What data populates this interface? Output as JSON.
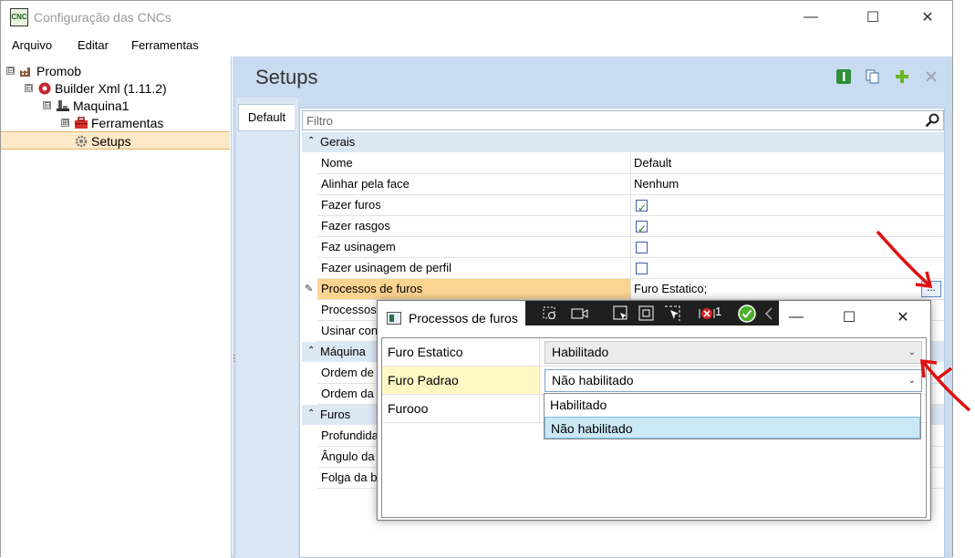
{
  "window": {
    "title": "Configuração das CNCs",
    "app_icon_text": "CNC",
    "controls": {
      "minimize": "—",
      "maximize": "☐",
      "close": "✕"
    }
  },
  "menu": [
    "Arquivo",
    "Editar",
    "Ferramentas"
  ],
  "tree": {
    "items": [
      {
        "label": "Promob",
        "expander": "⊟"
      },
      {
        "label": "Builder Xml (1.11.2)",
        "expander": "⊟"
      },
      {
        "label": "Maquina1",
        "expander": "⊟"
      },
      {
        "label": "Ferramentas",
        "expander": "⊞"
      },
      {
        "label": "Setups",
        "expander": ""
      }
    ]
  },
  "panel": {
    "title": "Setups",
    "tab": "Default",
    "filter_placeholder": "Filtro"
  },
  "grid": {
    "categories": [
      {
        "label": "Gerais"
      },
      {
        "label": "Máquina"
      },
      {
        "label": "Furos"
      }
    ],
    "gerais": [
      {
        "name": "Nome",
        "value": "Default"
      },
      {
        "name": "Alinhar pela face",
        "value": "Nenhum"
      },
      {
        "name": "Fazer furos",
        "checked": true
      },
      {
        "name": "Fazer rasgos",
        "checked": true
      },
      {
        "name": "Faz usinagem",
        "checked": false
      },
      {
        "name": "Fazer usinagem de perfil",
        "checked": false
      },
      {
        "name": "Processos de furos",
        "value": "Furo Estatico;",
        "button": "..."
      },
      {
        "name": "Processos"
      },
      {
        "name": "Usinar con"
      }
    ],
    "maquina": [
      {
        "name": "Ordem de"
      },
      {
        "name": "Ordem da"
      }
    ],
    "furos": [
      {
        "name": "Profundida"
      },
      {
        "name": "Ângulo da"
      },
      {
        "name": "Folga da b"
      }
    ]
  },
  "dialog": {
    "title": "Processos de furos",
    "debug_counter": "1",
    "rows": [
      {
        "name": "Furo Estatico",
        "value": "Habilitado"
      },
      {
        "name": "Furo Padrao",
        "value": "Não habilitado"
      },
      {
        "name": "Furooo",
        "value": ""
      }
    ],
    "dropdown_options": [
      "Habilitado",
      "Não habilitado"
    ]
  },
  "colors": {
    "accent": "#c9dbf0",
    "selection": "#fcd491",
    "annotation_arrow": "#e01010"
  }
}
